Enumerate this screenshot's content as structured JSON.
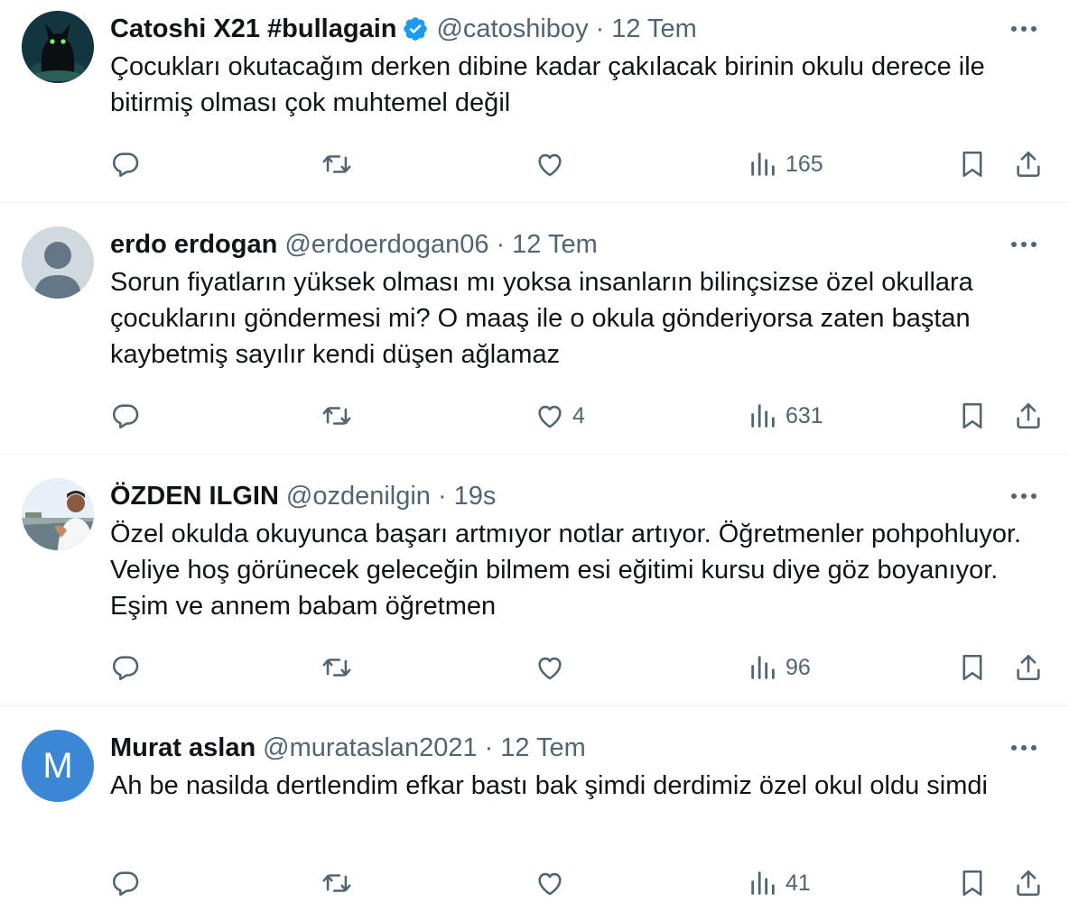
{
  "tweets": [
    {
      "name": "Catoshi X21 #bullagain",
      "verified": true,
      "handle": "@catoshiboy",
      "separator": "·",
      "time": "12 Tem",
      "text": "Çocukları okutacağım derken dibine kadar çakılacak birinin okulu derece ile bitirmiş olması çok muhtemel değil",
      "replies": "",
      "retweets": "",
      "likes": "",
      "views": "165",
      "avatar": "black-cat-avatar"
    },
    {
      "name": "erdo erdogan",
      "verified": false,
      "handle": "@erdoerdogan06",
      "separator": "·",
      "time": "12 Tem",
      "text": "Sorun fiyatların yüksek olması mı yoksa insanların bilinçsizse özel okullara çocuklarını göndermesi mi?  O maaş ile o okula gönderiyorsa zaten baştan kaybetmiş sayılır kendi düşen ağlamaz",
      "replies": "",
      "retweets": "",
      "likes": "4",
      "views": "631",
      "avatar": "default-profile-avatar"
    },
    {
      "name": "ÖZDEN ILGIN",
      "verified": false,
      "handle": "@ozdenilgin",
      "separator": "·",
      "time": "19s",
      "text": "Özel okulda okuyunca başarı artmıyor notlar artıyor. Öğretmenler pohpohluyor. Veliye hoş görünecek geleceğin bilmem esi eğitimi kursu diye göz boyanıyor. Eşim ve annem babam öğretmen",
      "replies": "",
      "retweets": "",
      "likes": "",
      "views": "96",
      "avatar": "photo-avatar"
    },
    {
      "name": "Murat aslan",
      "verified": false,
      "handle": "@murataslan2021",
      "separator": "·",
      "time": "12 Tem",
      "text": "Ah be nasilda dertlendim efkar bastı bak şimdi derdimiz özel okul oldu simdi",
      "replies": "",
      "retweets": "",
      "likes": "",
      "views": "41",
      "avatar": "letter-avatar",
      "avatar_letter": "M"
    }
  ],
  "colors": {
    "text": "#0f1419",
    "secondary": "#536471",
    "verified": "#1d9bf0",
    "letter_avatar": "#3b87d6",
    "divider": "#eff3f4"
  }
}
